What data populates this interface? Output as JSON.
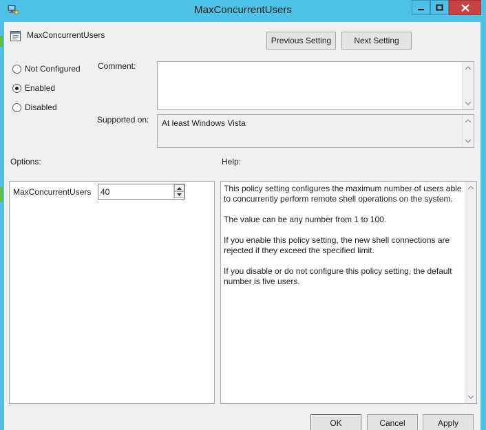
{
  "window": {
    "title": "MaxConcurrentUsers",
    "controls": [
      "minimize-icon",
      "maximize-icon",
      "close-icon"
    ]
  },
  "header": {
    "setting_name": "MaxConcurrentUsers",
    "previous_label": "Previous Setting",
    "next_label": "Next Setting"
  },
  "state": {
    "options": [
      {
        "label": "Not Configured",
        "checked": false
      },
      {
        "label": "Enabled",
        "checked": true
      },
      {
        "label": "Disabled",
        "checked": false
      }
    ]
  },
  "comment": {
    "label": "Comment:",
    "value": ""
  },
  "supported": {
    "label": "Supported on:",
    "value": "At least Windows Vista"
  },
  "options_panel": {
    "label": "Options:",
    "field_label": "MaxConcurrentUsers",
    "field_value": "40"
  },
  "help_panel": {
    "label": "Help:",
    "paragraphs": [
      "This policy setting configures the maximum number of users able to concurrently perform remote shell operations on the system.",
      "The value can be any  number from 1 to 100.",
      "If you enable this policy setting, the new shell connections are rejected if they exceed the specified limit.",
      "If you disable or do not configure this policy setting, the default number is five users."
    ]
  },
  "footer": {
    "ok_label": "OK",
    "cancel_label": "Cancel",
    "apply_label": "Apply"
  },
  "colors": {
    "titlebar": "#4ec1e6",
    "close_button": "#c74343",
    "dialog_background": "#f0f0f0"
  }
}
